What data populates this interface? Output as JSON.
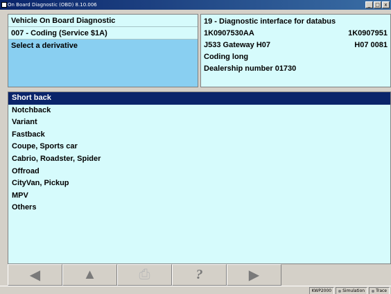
{
  "window": {
    "title": "On Board Diagnostic (OBD) 8.10.006",
    "buttons": {
      "minimize": "_",
      "restore": "□",
      "close": "x"
    }
  },
  "header_left": {
    "title": "Vehicle On Board Diagnostic",
    "function": "007 - Coding (Service $1A)",
    "prompt": "Select a derivative"
  },
  "header_right": {
    "module": "19 - Diagnostic interface for databus",
    "part_number": "1K0907530AA",
    "part_number_right": "1K0907951",
    "component": "J533  Gateway  H07",
    "component_right": "H07  0081",
    "coding": "Coding long",
    "dealership": "Dealership number 01730"
  },
  "list": {
    "items": [
      "Short back",
      "Notchback",
      "Variant",
      "Fastback",
      "Coupe, Sports car",
      "Cabrio, Roadster, Spider",
      "Offroad",
      "CityVan, Pickup",
      "MPV",
      "Others"
    ],
    "selected_index": 0
  },
  "toolbar": {
    "icons": [
      "back-arrow-icon",
      "up-arrow-icon",
      "print-icon",
      "help-icon",
      "forward-arrow-icon"
    ],
    "glyphs": {
      "back": "◀",
      "up": "▲",
      "print": "⎙",
      "help": "?",
      "forward": "▶"
    }
  },
  "status": {
    "protocol": "KWP2000",
    "simulation": "Simulation",
    "trace": "Trace"
  },
  "colors": {
    "panel_bg": "#d6fbfc",
    "prompt_bg": "#89cff1",
    "selection_bg": "#0a246a",
    "title_bar": "#0a246a"
  }
}
